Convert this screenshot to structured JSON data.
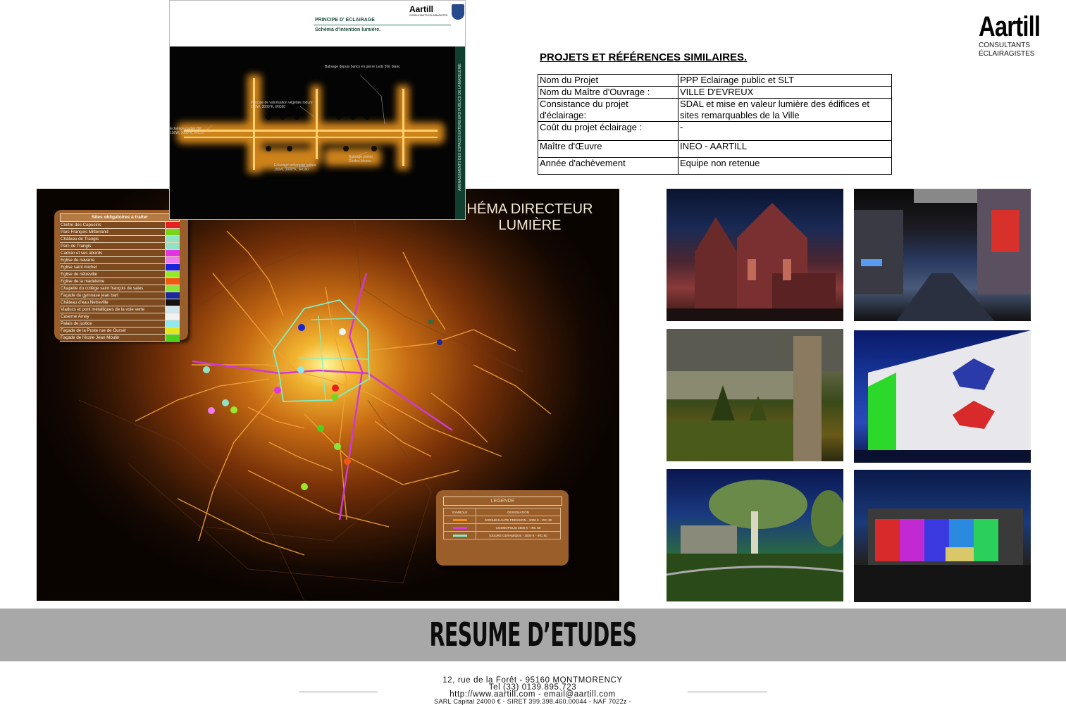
{
  "logo": {
    "name": "Aartill",
    "line1": "CONSULTANTS",
    "line2": "ÉCLAIRAGISTES"
  },
  "projects": {
    "title": "PROJETS ET RÉFÉRENCES SIMILAIRES.",
    "rows": [
      {
        "key": "Nom du Projet",
        "value": "PPP Eclairage public et SLT"
      },
      {
        "key": "Nom du Maître d'Ouvrage :",
        "value": "VILLE D'EVREUX"
      },
      {
        "key": "Consistance du projet d'éclairage:",
        "value": "SDAL et mise en valeur lumière des édifices et sites remarquables de la Ville"
      },
      {
        "key": "Coût du projet éclairage :",
        "value": "-"
      },
      {
        "key": "Maître d'Œuvre",
        "value": "INEO - AARTILL"
      },
      {
        "key": "Année d'achèvement",
        "value": "Equipe non retenue"
      }
    ]
  },
  "plan": {
    "title": "PRINCIPE D' ECLAIRAGE",
    "subtitle": "Schéma d'intention lumière.",
    "logo": "Aartill",
    "logo_sub": "CONSULTANTS ÉCLAIRAGISTES",
    "side_text": "AMENAGEMENTS DES ESPACES EXTERIEURS PUBLICS DE LA MADELEINE",
    "labels": [
      "Balisage depuis bancs en pierre Leds 5W, blanc",
      "Principe de valorisation végétale Iodure 150W, 3000°K, IRC80",
      "Eclairage routier HP 150W, 2000°K, IRC20",
      "Eclairage piétonnier Iodure 150W, 3000°K, IRC80",
      "Balisage piéton Diodes bleues"
    ]
  },
  "map": {
    "title_line1": "HÉMA DIRECTEUR",
    "title_line2": "LUMIÈRE",
    "sites_title": "Sites obligatoires à traiter",
    "sites": [
      {
        "name": "Cloître des Capucins",
        "color": "#e32121"
      },
      {
        "name": "Parc François Mitterrand",
        "color": "#7ad41c"
      },
      {
        "name": "Château de Trangis",
        "color": "#8fe4c8"
      },
      {
        "name": "Parc de Trangis",
        "color": "#8fe4c8"
      },
      {
        "name": "Cadran et ses abords",
        "color": "#e234e2"
      },
      {
        "name": "Eglise de navarre",
        "color": "#f07aef"
      },
      {
        "name": "Eglise saint michel",
        "color": "#1a24d6"
      },
      {
        "name": "Eglise de nétreville",
        "color": "#96e82a"
      },
      {
        "name": "Eglise de la madeleine",
        "color": "#f05a10"
      },
      {
        "name": "Chapelle du collège saint françois de sales",
        "color": "#8ae63a"
      },
      {
        "name": "Façade du gymnase jean bart",
        "color": "#1a2a9a"
      },
      {
        "name": "Château d'eau Netreville",
        "color": "#121212"
      },
      {
        "name": "Viaducs et pont métalliques de la voie verte",
        "color": "#cfe6f2"
      },
      {
        "name": "Caserne Amey",
        "color": "#f2f2f2"
      },
      {
        "name": "Palais de justice",
        "color": "#8ee8f0"
      },
      {
        "name": "Façade de la Poste rue de Oursel",
        "color": "#e2e81c"
      },
      {
        "name": "Façade de l'école Jean Moulin",
        "color": "#4ad21c"
      }
    ],
    "legend": {
      "title": "LEGENDE",
      "col_symbol": "SYMBOLE",
      "col_desc": "DESIGNATION",
      "rows": [
        {
          "color": "#f28a20",
          "desc": "SODIUM HAUTE PRESSION - 2000 K - IRC 20"
        },
        {
          "color": "#d63ad8",
          "desc": "COSMOPOLIS 2800 K - IRC 60"
        },
        {
          "color": "#7ef0c8",
          "desc": "IODURE CERAMIQUE - 3000 K - IRC 80"
        }
      ]
    }
  },
  "banner": {
    "text": "RESUME D’ETUDES"
  },
  "footer": {
    "line1": "12, rue de la Forêt - 95160 MONTMORENCY",
    "line2": "Tel  (33) 0139.895.723",
    "line3": "http://www.aartill.com - email@aartill.com",
    "line4": "SARL Capital 24000 € - SIRET 399.398.460.00044 - NAF 7022z -"
  },
  "colors": {
    "banner_bg": "#a8a8a8",
    "map_glow": "#fff79a"
  }
}
